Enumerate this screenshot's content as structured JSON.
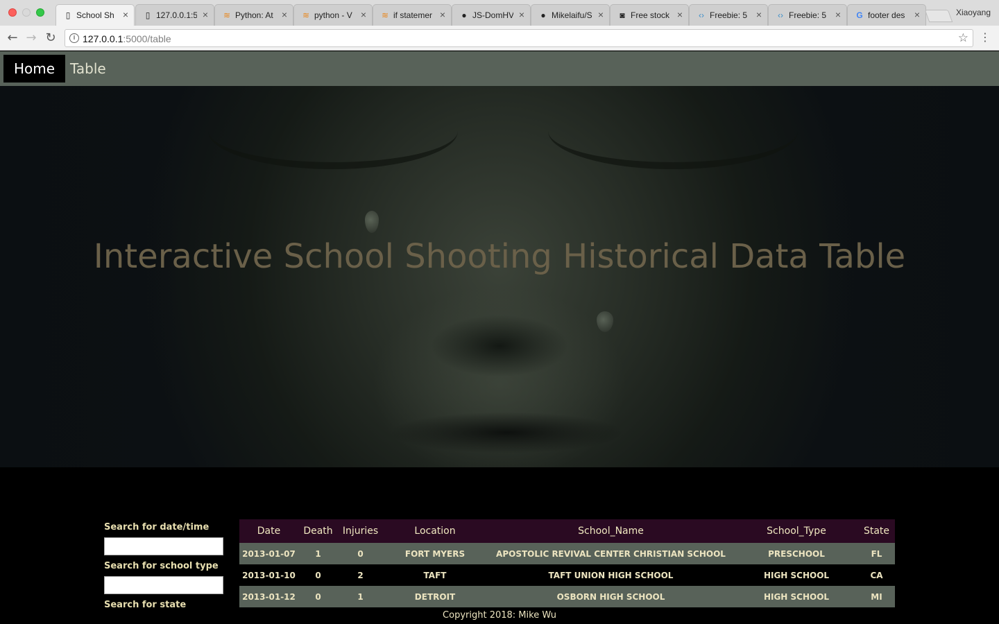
{
  "browser": {
    "tabs": [
      {
        "title": "School Sh",
        "icon": "page-icon",
        "active": true
      },
      {
        "title": "127.0.0.1:5",
        "icon": "page-icon",
        "active": false
      },
      {
        "title": "Python: At",
        "icon": "stackoverflow-icon",
        "active": false
      },
      {
        "title": "python - V",
        "icon": "stackoverflow-icon",
        "active": false
      },
      {
        "title": "if statemer",
        "icon": "stackoverflow-icon",
        "active": false
      },
      {
        "title": "JS-DomHV",
        "icon": "github-icon",
        "active": false
      },
      {
        "title": "Mikelaifu/S",
        "icon": "github-icon",
        "active": false
      },
      {
        "title": "Free stock",
        "icon": "camera-icon",
        "active": false
      },
      {
        "title": "Freebie: 5",
        "icon": "code-icon",
        "active": false
      },
      {
        "title": "Freebie: 5",
        "icon": "code-icon",
        "active": false
      },
      {
        "title": "footer des",
        "icon": "google-icon",
        "active": false
      }
    ],
    "profile_name": "Xiaoyang",
    "url_host": "127.0.0.1",
    "url_path": ":5000/table"
  },
  "nav": {
    "home_label": "Home",
    "table_label": "Table"
  },
  "hero": {
    "title": "Interactive School Shooting Historical Data Table"
  },
  "filters": {
    "date_label": "Search for date/time",
    "date_value": "",
    "school_type_label": "Search for school type",
    "school_type_value": "",
    "state_label": "Search for state"
  },
  "table": {
    "headers": [
      "Date",
      "Death",
      "Injuries",
      "Location",
      "School_Name",
      "School_Type",
      "State"
    ],
    "rows": [
      [
        "2013-01-07",
        "1",
        "0",
        "FORT MYERS",
        "APOSTOLIC REVIVAL CENTER CHRISTIAN SCHOOL",
        "PRESCHOOL",
        "FL"
      ],
      [
        "2013-01-10",
        "0",
        "2",
        "TAFT",
        "TAFT UNION HIGH SCHOOL",
        "HIGH SCHOOL",
        "CA"
      ],
      [
        "2013-01-12",
        "0",
        "1",
        "DETROIT",
        "OSBORN HIGH SCHOOL",
        "HIGH SCHOOL",
        "MI"
      ]
    ]
  },
  "footer": {
    "copyright": "Copyright 2018: Mike Wu"
  },
  "colors": {
    "nav_bg": "#586259",
    "table_header_bg": "#2a0a22",
    "row_odd_bg": "#586259",
    "row_even_bg": "#000000",
    "text_cream": "#ece4c0"
  }
}
